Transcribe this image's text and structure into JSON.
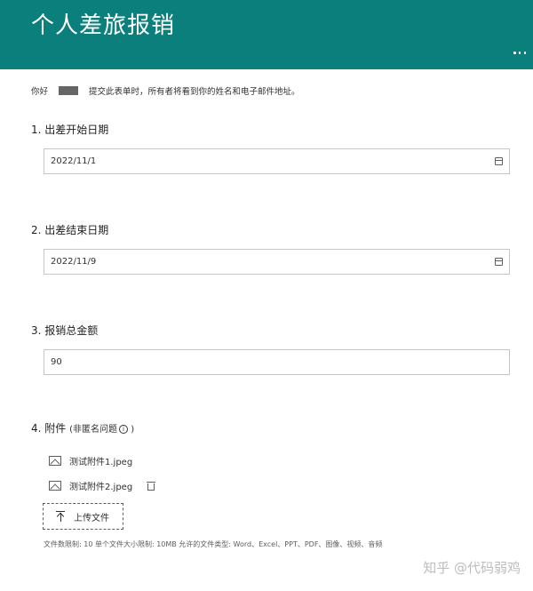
{
  "header": {
    "title": "个人差旅报销",
    "accent_color": "#0b7f7c"
  },
  "greeting": {
    "hello": "你好",
    "notice": "提交此表单时，所有者将看到你的姓名和电子邮件地址。"
  },
  "questions": [
    {
      "title": "1. 出差开始日期",
      "value": "2022/11/1",
      "icon": "calendar-icon"
    },
    {
      "title": "2. 出差结束日期",
      "value": "2022/11/9",
      "icon": "calendar-icon"
    },
    {
      "title": "3. 报销总金额",
      "value": "90"
    },
    {
      "title": "4. 附件",
      "subtitle": "(非匿名问题",
      "subtitle_close": ")",
      "info_glyph": "i"
    }
  ],
  "attachments": [
    {
      "name": "测试附件1.jpeg",
      "icon": "image-icon"
    },
    {
      "name": "测试附件2.jpeg",
      "icon": "image-icon",
      "delete_icon": "trash-icon"
    }
  ],
  "upload": {
    "label": "上传文件",
    "limits": "文件数限制: 10    单个文件大小限制: 10MB    允许的文件类型: Word、Excel、PPT、PDF、图像、视频、音频"
  },
  "watermark": "知乎 @代码弱鸡"
}
